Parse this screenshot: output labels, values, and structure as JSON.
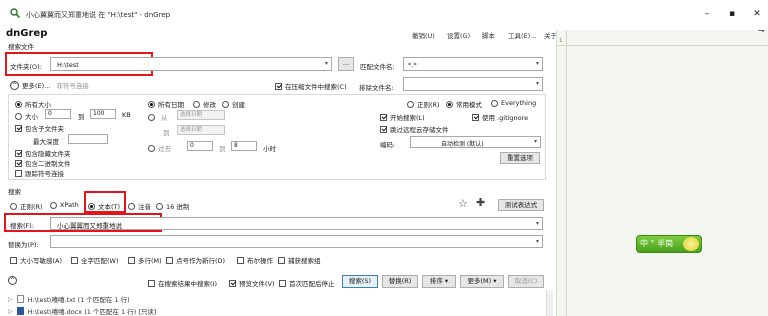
{
  "window": {
    "title": "小心翼翼而又郑重地说 在 \"H:\\test\" - dnGrep",
    "controls": {
      "minimize": "–",
      "maximize": "▪",
      "close": "✕"
    }
  },
  "app": {
    "name": "dnGrep",
    "menu": [
      "撤销(U)",
      "设置(G)",
      "脚本",
      "工具(E)...",
      "关于(A)"
    ],
    "search_file_label": "搜索文件"
  },
  "folder": {
    "label": "文件夹(O):",
    "value": "H:\\test",
    "browse_label": "...",
    "match_label": "匹配文件名:",
    "match_value": "*.*"
  },
  "more_row": {
    "expand_label": "更多(E)...",
    "subtext": "非符号连接",
    "archive_label": "在压缩文件中搜索(C)",
    "exclude_label": "排除文件名:"
  },
  "filters": {
    "size_all": "所有大小",
    "size_label": "大小",
    "size_from": "0",
    "size_to_label": "到",
    "size_to": "100",
    "size_unit": "KB",
    "include_subfolders": "包含子文件夹",
    "max_depth_label": "最大深度",
    "include_hidden": "包含隐藏文件夹",
    "include_binary": "包含二进制文件",
    "follow_symlinks": "跟踪符号连接",
    "date_all": "所有日期",
    "date_modified": "修改",
    "date_created": "创建",
    "date_from_label": "从",
    "date_to_label": "到",
    "date_placeholder": "选择日期",
    "past_label": "过去",
    "past_from": "0",
    "past_to": "8",
    "hours_label": "小时",
    "mode_regex": "正则(R)",
    "mode_wildcard": "常用模式",
    "mode_everything": "Everything",
    "open_search": "开始搜索(L)",
    "use_gitignore": "使用 .gitignore",
    "skip_cloud": "跳过远程云存储文件",
    "encoding_label": "编码:",
    "encoding_value": "自动检测 (默认)",
    "reset_label": "重置选项"
  },
  "search": {
    "section_label": "搜索",
    "type_regex": "正则(R)",
    "type_xpath": "XPath",
    "type_text": "文本(T)",
    "type_phonetic": "注音",
    "type_hex": "16 进制",
    "test_label": "测试表达式",
    "search_for_label": "搜索(F):",
    "search_for_value": "小心翼翼而又郑重地说",
    "replace_label": "替换为(P):",
    "replace_value": ""
  },
  "options": {
    "case_sensitive": "大小写敏感(A)",
    "whole_word": "全字匹配(W)",
    "multiline": "多行(M)",
    "dot_newline": "点号作为新行(D)",
    "boolean_ops": "布尔操作",
    "capture_group": "捕获搜索组"
  },
  "actions": {
    "search_in_results": "在搜索结果中搜索(I)",
    "preview_file": "预览文件(V)",
    "stop_after_first": "首次匹配后停止",
    "search_btn": "搜索(S)",
    "replace_btn": "替换(R)",
    "sort_btn": "排序",
    "more_btn": "更多(M)",
    "cancel_btn": "取消(C)"
  },
  "results": [
    "H:\\test\\嘻嘻.txt (1 个匹配在 1 行)",
    "H:\\test\\嘻嘻.docx (1 个匹配在 1 行) [只读]"
  ],
  "right_pane": {
    "line_number": "1"
  },
  "ime": {
    "label": "中 ° 半简"
  }
}
